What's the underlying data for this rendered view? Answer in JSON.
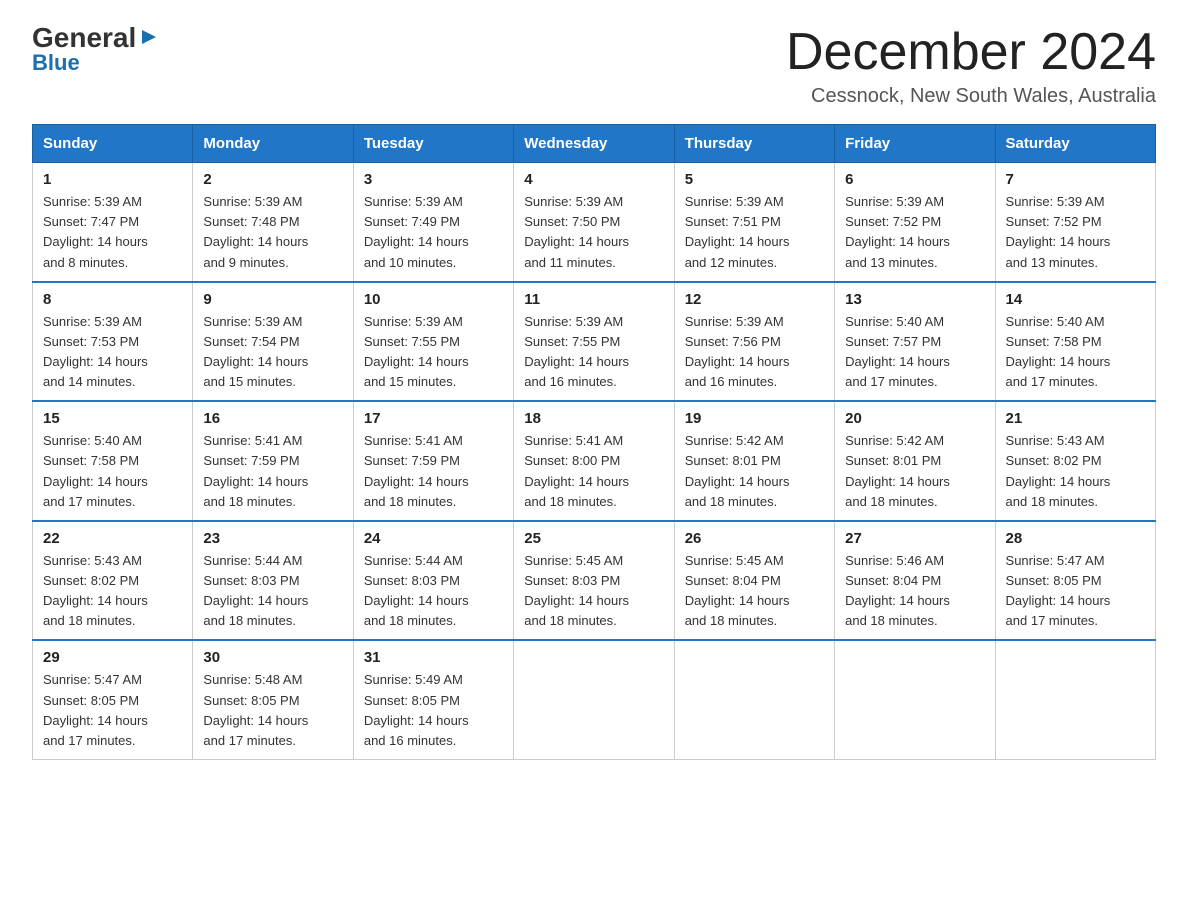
{
  "header": {
    "logo_general": "General",
    "logo_blue": "Blue",
    "title": "December 2024",
    "subtitle": "Cessnock, New South Wales, Australia"
  },
  "days_of_week": [
    "Sunday",
    "Monday",
    "Tuesday",
    "Wednesday",
    "Thursday",
    "Friday",
    "Saturday"
  ],
  "weeks": [
    [
      {
        "day": "1",
        "sunrise": "5:39 AM",
        "sunset": "7:47 PM",
        "daylight": "14 hours and 8 minutes."
      },
      {
        "day": "2",
        "sunrise": "5:39 AM",
        "sunset": "7:48 PM",
        "daylight": "14 hours and 9 minutes."
      },
      {
        "day": "3",
        "sunrise": "5:39 AM",
        "sunset": "7:49 PM",
        "daylight": "14 hours and 10 minutes."
      },
      {
        "day": "4",
        "sunrise": "5:39 AM",
        "sunset": "7:50 PM",
        "daylight": "14 hours and 11 minutes."
      },
      {
        "day": "5",
        "sunrise": "5:39 AM",
        "sunset": "7:51 PM",
        "daylight": "14 hours and 12 minutes."
      },
      {
        "day": "6",
        "sunrise": "5:39 AM",
        "sunset": "7:52 PM",
        "daylight": "14 hours and 13 minutes."
      },
      {
        "day": "7",
        "sunrise": "5:39 AM",
        "sunset": "7:52 PM",
        "daylight": "14 hours and 13 minutes."
      }
    ],
    [
      {
        "day": "8",
        "sunrise": "5:39 AM",
        "sunset": "7:53 PM",
        "daylight": "14 hours and 14 minutes."
      },
      {
        "day": "9",
        "sunrise": "5:39 AM",
        "sunset": "7:54 PM",
        "daylight": "14 hours and 15 minutes."
      },
      {
        "day": "10",
        "sunrise": "5:39 AM",
        "sunset": "7:55 PM",
        "daylight": "14 hours and 15 minutes."
      },
      {
        "day": "11",
        "sunrise": "5:39 AM",
        "sunset": "7:55 PM",
        "daylight": "14 hours and 16 minutes."
      },
      {
        "day": "12",
        "sunrise": "5:39 AM",
        "sunset": "7:56 PM",
        "daylight": "14 hours and 16 minutes."
      },
      {
        "day": "13",
        "sunrise": "5:40 AM",
        "sunset": "7:57 PM",
        "daylight": "14 hours and 17 minutes."
      },
      {
        "day": "14",
        "sunrise": "5:40 AM",
        "sunset": "7:58 PM",
        "daylight": "14 hours and 17 minutes."
      }
    ],
    [
      {
        "day": "15",
        "sunrise": "5:40 AM",
        "sunset": "7:58 PM",
        "daylight": "14 hours and 17 minutes."
      },
      {
        "day": "16",
        "sunrise": "5:41 AM",
        "sunset": "7:59 PM",
        "daylight": "14 hours and 18 minutes."
      },
      {
        "day": "17",
        "sunrise": "5:41 AM",
        "sunset": "7:59 PM",
        "daylight": "14 hours and 18 minutes."
      },
      {
        "day": "18",
        "sunrise": "5:41 AM",
        "sunset": "8:00 PM",
        "daylight": "14 hours and 18 minutes."
      },
      {
        "day": "19",
        "sunrise": "5:42 AM",
        "sunset": "8:01 PM",
        "daylight": "14 hours and 18 minutes."
      },
      {
        "day": "20",
        "sunrise": "5:42 AM",
        "sunset": "8:01 PM",
        "daylight": "14 hours and 18 minutes."
      },
      {
        "day": "21",
        "sunrise": "5:43 AM",
        "sunset": "8:02 PM",
        "daylight": "14 hours and 18 minutes."
      }
    ],
    [
      {
        "day": "22",
        "sunrise": "5:43 AM",
        "sunset": "8:02 PM",
        "daylight": "14 hours and 18 minutes."
      },
      {
        "day": "23",
        "sunrise": "5:44 AM",
        "sunset": "8:03 PM",
        "daylight": "14 hours and 18 minutes."
      },
      {
        "day": "24",
        "sunrise": "5:44 AM",
        "sunset": "8:03 PM",
        "daylight": "14 hours and 18 minutes."
      },
      {
        "day": "25",
        "sunrise": "5:45 AM",
        "sunset": "8:03 PM",
        "daylight": "14 hours and 18 minutes."
      },
      {
        "day": "26",
        "sunrise": "5:45 AM",
        "sunset": "8:04 PM",
        "daylight": "14 hours and 18 minutes."
      },
      {
        "day": "27",
        "sunrise": "5:46 AM",
        "sunset": "8:04 PM",
        "daylight": "14 hours and 18 minutes."
      },
      {
        "day": "28",
        "sunrise": "5:47 AM",
        "sunset": "8:05 PM",
        "daylight": "14 hours and 17 minutes."
      }
    ],
    [
      {
        "day": "29",
        "sunrise": "5:47 AM",
        "sunset": "8:05 PM",
        "daylight": "14 hours and 17 minutes."
      },
      {
        "day": "30",
        "sunrise": "5:48 AM",
        "sunset": "8:05 PM",
        "daylight": "14 hours and 17 minutes."
      },
      {
        "day": "31",
        "sunrise": "5:49 AM",
        "sunset": "8:05 PM",
        "daylight": "14 hours and 16 minutes."
      },
      null,
      null,
      null,
      null
    ]
  ],
  "labels": {
    "sunrise": "Sunrise:",
    "sunset": "Sunset:",
    "daylight": "Daylight:"
  }
}
